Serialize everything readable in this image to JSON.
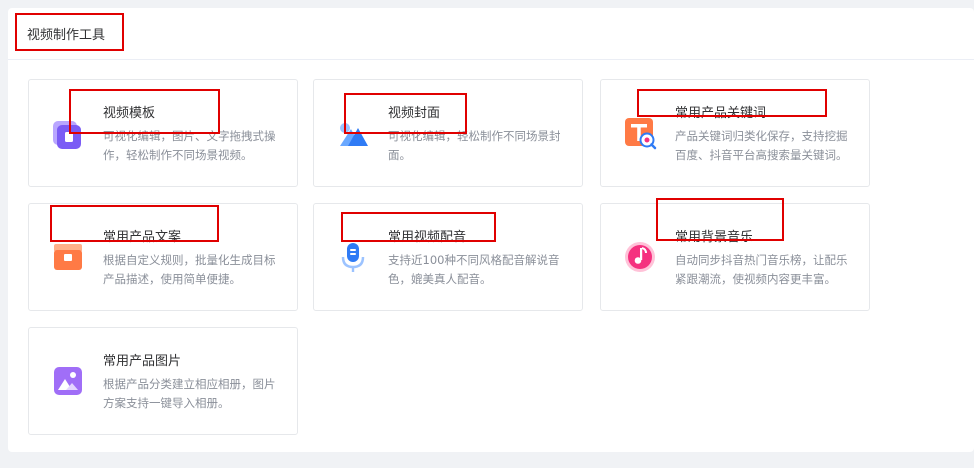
{
  "section": {
    "title": "视频制作工具"
  },
  "cards": [
    {
      "title": "视频模板",
      "desc": "可视化编辑，图片、文字拖拽式操作，轻松制作不同场景视频。",
      "icon": "video-template-icon"
    },
    {
      "title": "视频封面",
      "desc": "可视化编辑，轻松制作不同场景封面。",
      "icon": "video-cover-icon"
    },
    {
      "title": "常用产品关键词",
      "desc": "产品关键词归类化保存，支持挖掘百度、抖音平台高搜索量关键词。",
      "icon": "keyword-search-icon"
    },
    {
      "title": "常用产品文案",
      "desc": "根据自定义规则，批量化生成目标产品描述，使用简单便捷。",
      "icon": "product-copy-icon"
    },
    {
      "title": "常用视频配音",
      "desc": "支持近100种不同风格配音解说音色，媲美真人配音。",
      "icon": "microphone-icon"
    },
    {
      "title": "常用背景音乐",
      "desc": "自动同步抖音热门音乐榜，让配乐紧跟潮流，使视频内容更丰富。",
      "icon": "music-note-icon"
    },
    {
      "title": "常用产品图片",
      "desc": "根据产品分类建立相应相册，图片方案支持一键导入相册。",
      "icon": "image-icon"
    }
  ],
  "colors": {
    "highlight": "#e00000",
    "purple": "#7b5cf5",
    "blue": "#2f7bf5",
    "orange": "#ff7a45",
    "pink": "#f5317f",
    "violet": "#a06ef7"
  }
}
